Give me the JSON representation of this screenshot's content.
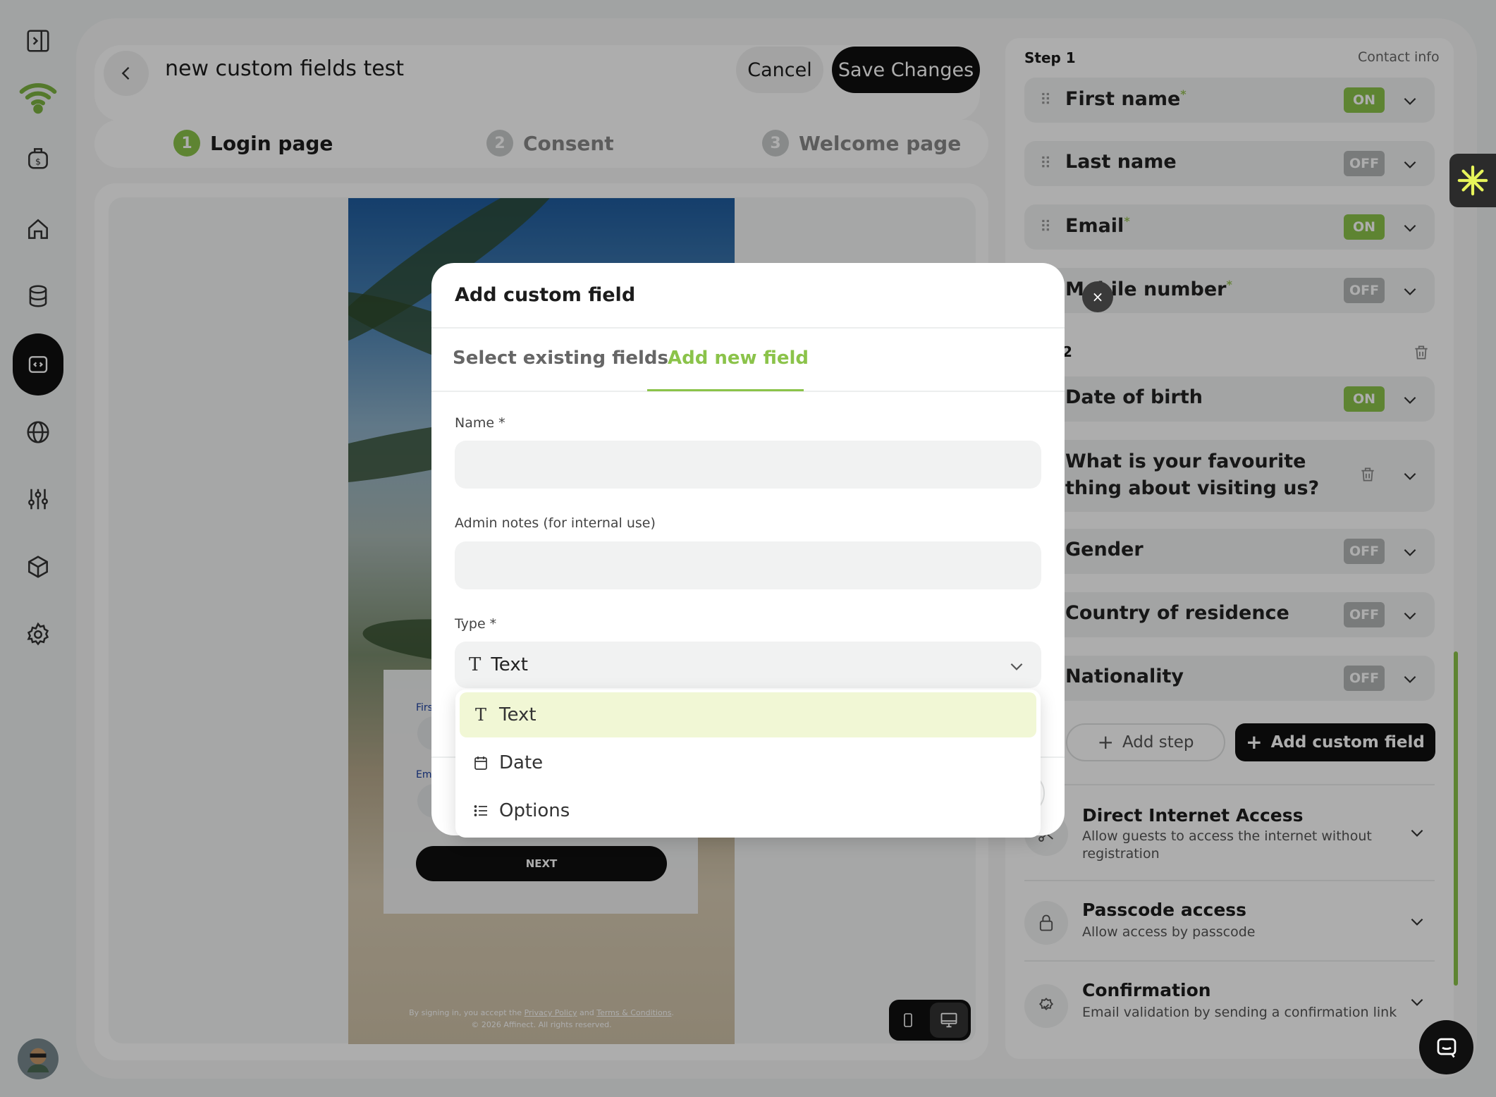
{
  "app": {
    "title": "new custom fields test",
    "cancel_label": "Cancel",
    "save_label": "Save Changes"
  },
  "steps": [
    {
      "num": "1",
      "label": "Login page"
    },
    {
      "num": "2",
      "label": "Consent"
    },
    {
      "num": "3",
      "label": "Welcome page"
    }
  ],
  "preview": {
    "label_first": "Firs",
    "label_email": "Em",
    "next_label": "NEXT",
    "legal_prefix": "By signing in, you accept the ",
    "privacy_link": "Privacy Policy",
    "legal_and": " and ",
    "terms_link": "Terms & Conditions",
    "legal_suffix": ".",
    "copyright": "© 2026 Affinect. All rights reserved."
  },
  "right_panel": {
    "step1_label": "Step 1",
    "step1_right": "Contact info",
    "fields": [
      {
        "name": "First name",
        "required": "*",
        "status": "ON"
      },
      {
        "name": "Last name",
        "required": "",
        "status": "OFF"
      },
      {
        "name": "Email",
        "required": "*",
        "status": "ON"
      },
      {
        "name": "Mobile number",
        "required": "*",
        "status": "OFF"
      }
    ],
    "step2_partial": "2",
    "fields2": [
      {
        "name": "Date of birth",
        "status": "ON"
      },
      {
        "name": "What is your favourite thing about visiting us?",
        "status": ""
      },
      {
        "name": "Gender",
        "status": "OFF"
      },
      {
        "name": "Country of residence",
        "status": "OFF"
      },
      {
        "name": "Nationality",
        "status": "OFF"
      }
    ],
    "add_step_label": "Add step",
    "add_custom_field_label": "Add custom field",
    "access": [
      {
        "title": "Direct Internet Access",
        "desc": "Allow guests to access the internet without registration",
        "icon": "scissors-icon"
      },
      {
        "title": "Passcode access",
        "desc": "Allow access by passcode",
        "icon": "lock-icon"
      },
      {
        "title": "Confirmation",
        "desc": "Email validation by sending a confirmation link",
        "icon": "badge-check-icon"
      }
    ]
  },
  "modal": {
    "title": "Add custom field",
    "tabs": [
      "Select existing fields",
      "Add new field"
    ],
    "active_tab": "Add new field",
    "name_label": "Name *",
    "name_value": "",
    "admin_notes_label": "Admin notes (for internal use)",
    "admin_notes_value": "",
    "type_label": "Type *",
    "type_value": "Text",
    "type_options": [
      {
        "label": "Text",
        "icon": "text-type-icon"
      },
      {
        "label": "Date",
        "icon": "calendar-icon"
      },
      {
        "label": "Options",
        "icon": "list-icon"
      }
    ],
    "close_label": "×"
  },
  "colors": {
    "accent": "#8bc34a",
    "dark": "#0f0f0f",
    "overlay": "rgba(0,0,0,0.32)"
  }
}
